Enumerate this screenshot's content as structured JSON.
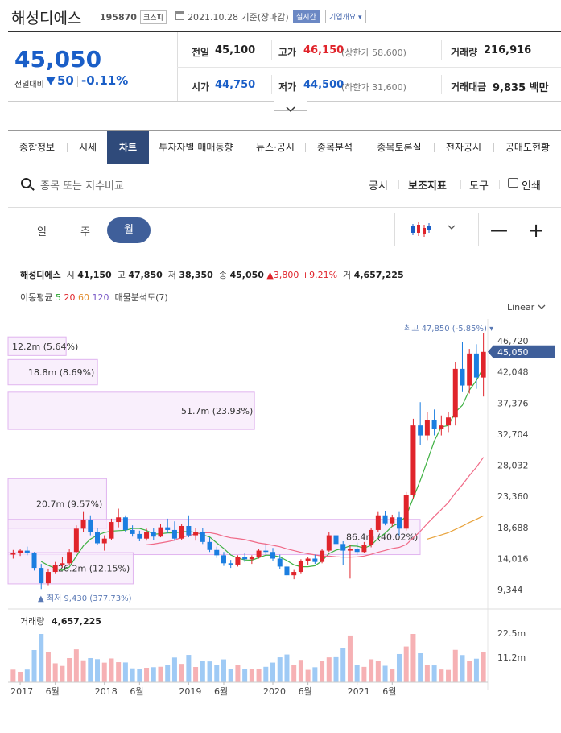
{
  "header": {
    "name": "해성디에스",
    "code": "195870",
    "market": "코스피",
    "date": "2021.10.28 기준(장마감)",
    "realtime": "실시간",
    "corp_overview": "기업개요 ▾"
  },
  "price": {
    "current": "45,050",
    "change_label": "전일대비",
    "change": "50",
    "change_pct": "-0.11%",
    "color": "#1a5ec7"
  },
  "quote": {
    "prev_label": "전일",
    "prev": "45,100",
    "high_label": "고가",
    "high": "46,150",
    "high_limit": "(상한가 58,600)",
    "volume_label": "거래량",
    "volume": "216,916",
    "open_label": "시가",
    "open": "44,750",
    "low_label": "저가",
    "low": "44,500",
    "low_limit": "(하한가 31,600)",
    "amount_label": "거래대금",
    "amount": "9,835 백만"
  },
  "tabs": [
    "종합정보",
    "시세",
    "차트",
    "투자자별 매매동향",
    "뉴스·공시",
    "종목분석",
    "종목토론실",
    "전자공시",
    "공매도현황"
  ],
  "toolbar": {
    "search_placeholder": "종목 또는 지수비교",
    "notice": "공시",
    "indicator": "보조지표",
    "tools": "도구",
    "print": "인쇄"
  },
  "period": {
    "day": "일",
    "week": "주",
    "month": "월"
  },
  "info": {
    "name": "해성디에스",
    "open_label": "시",
    "open": "41,150",
    "high_label": "고",
    "high": "47,850",
    "low_label": "저",
    "low": "38,350",
    "close_label": "종",
    "close": "45,050",
    "change": "▲3,800",
    "pct": "+9.21%",
    "vol_label": "거",
    "volume": "4,657,225",
    "ma_label": "이동평균",
    "ma5": "5",
    "ma20": "20",
    "ma60": "60",
    "ma120": "120",
    "vp_label": "매물분석도(7)"
  },
  "scale": "Linear",
  "chart_data": {
    "type": "candlestick",
    "frequency": "monthly",
    "y_ticks": [
      46720,
      42048,
      37376,
      32704,
      28032,
      23360,
      18688,
      14016,
      9344
    ],
    "y_tick_labels": [
      "46,720",
      "42,048",
      "37,376",
      "32,704",
      "28,032",
      "23,360",
      "18,688",
      "14,016",
      "9,344"
    ],
    "current_price_tag": "45,050",
    "high_note": "최고 47,850 (-5.85%)",
    "low_note": "▲ 최저 9,430 (377.73%)",
    "x_labels": [
      "2017",
      "6월",
      "2018",
      "6월",
      "2019",
      "6월",
      "2020",
      "6월",
      "2021",
      "6월"
    ],
    "volume_profile": [
      {
        "label": "12.2m (5.64%)",
        "pct": 5.64
      },
      {
        "label": "18.8m (8.69%)",
        "pct": 8.69
      },
      {
        "label": "51.7m (23.93%)",
        "pct": 23.93
      },
      {
        "label": "20.7m (9.57%)",
        "pct": 9.57
      },
      {
        "label": "86.4m (40.02%)",
        "pct": 40.02
      },
      {
        "label": "26.2m (12.15%)",
        "pct": 12.15
      }
    ],
    "candles": [
      [
        14600,
        15300,
        14000,
        14900
      ],
      [
        14900,
        15500,
        14400,
        15200
      ],
      [
        15200,
        15800,
        14500,
        14800
      ],
      [
        14800,
        15000,
        12200,
        12600
      ],
      [
        12600,
        13200,
        9430,
        10300
      ],
      [
        10300,
        12500,
        10000,
        12000
      ],
      [
        12000,
        13500,
        11800,
        13000
      ],
      [
        13000,
        14200,
        12700,
        13300
      ],
      [
        13300,
        15500,
        13000,
        15000
      ],
      [
        15000,
        19000,
        14800,
        18500
      ],
      [
        18500,
        21000,
        18000,
        19800
      ],
      [
        19800,
        20500,
        17500,
        18000
      ],
      [
        18000,
        18600,
        16000,
        16300
      ],
      [
        16300,
        17500,
        15200,
        17000
      ],
      [
        17000,
        20000,
        16800,
        19500
      ],
      [
        19500,
        21500,
        18700,
        20200
      ],
      [
        20200,
        20500,
        18000,
        18300
      ],
      [
        18300,
        19000,
        17300,
        17700
      ],
      [
        17700,
        18200,
        16600,
        17000
      ],
      [
        17000,
        18500,
        16700,
        18000
      ],
      [
        18000,
        18600,
        16800,
        17300
      ],
      [
        17300,
        19200,
        17200,
        18700
      ],
      [
        18700,
        20000,
        17800,
        18300
      ],
      [
        18300,
        19600,
        16700,
        17000
      ],
      [
        17000,
        19200,
        16800,
        18900
      ],
      [
        18900,
        20500,
        17200,
        17500
      ],
      [
        17500,
        18600,
        16700,
        18000
      ],
      [
        18000,
        18600,
        16200,
        16500
      ],
      [
        16500,
        17200,
        15000,
        15300
      ],
      [
        15300,
        15800,
        14100,
        14500
      ],
      [
        14500,
        15000,
        12900,
        13300
      ],
      [
        13300,
        13800,
        12600,
        13100
      ],
      [
        13100,
        14500,
        12800,
        14200
      ],
      [
        14200,
        14800,
        13500,
        13900
      ],
      [
        13900,
        14500,
        13200,
        14300
      ],
      [
        14300,
        15400,
        14000,
        15200
      ],
      [
        15200,
        16200,
        14600,
        15000
      ],
      [
        15000,
        15600,
        13700,
        14000
      ],
      [
        14000,
        14600,
        12400,
        12800
      ],
      [
        12800,
        13200,
        11000,
        11500
      ],
      [
        11500,
        12300,
        10900,
        12000
      ],
      [
        12000,
        13900,
        11800,
        13600
      ],
      [
        13600,
        14200,
        13000,
        14000
      ],
      [
        14000,
        14600,
        13200,
        13500
      ],
      [
        13500,
        15500,
        13300,
        15200
      ],
      [
        15200,
        18000,
        15000,
        17500
      ],
      [
        17500,
        18600,
        15800,
        16200
      ],
      [
        16200,
        16600,
        13000,
        15200
      ],
      [
        15200,
        16000,
        11000,
        15500
      ],
      [
        15500,
        16400,
        14600,
        15000
      ],
      [
        15000,
        16500,
        14800,
        16000
      ],
      [
        16000,
        18600,
        15700,
        18300
      ],
      [
        18300,
        21000,
        18000,
        20500
      ],
      [
        20500,
        21200,
        19000,
        19300
      ],
      [
        19300,
        20600,
        18800,
        20200
      ],
      [
        20200,
        21000,
        17400,
        18500
      ],
      [
        18500,
        24000,
        18200,
        23500
      ],
      [
        23500,
        35000,
        23000,
        34000
      ],
      [
        34000,
        37500,
        31000,
        32500
      ],
      [
        32500,
        36000,
        31800,
        34800
      ],
      [
        34800,
        36400,
        32500,
        33500
      ],
      [
        33500,
        35500,
        32500,
        34000
      ],
      [
        34000,
        36000,
        33000,
        35200
      ],
      [
        35200,
        43500,
        34000,
        42500
      ],
      [
        42500,
        46500,
        39000,
        40000
      ],
      [
        40000,
        45500,
        38800,
        44800
      ],
      [
        44800,
        46200,
        39500,
        41200
      ],
      [
        41200,
        47850,
        38350,
        45050
      ]
    ],
    "volume_axis": [
      "22.5m",
      "11.2m"
    ],
    "volume_label": "거래량",
    "volume_total": "4,657,225"
  }
}
